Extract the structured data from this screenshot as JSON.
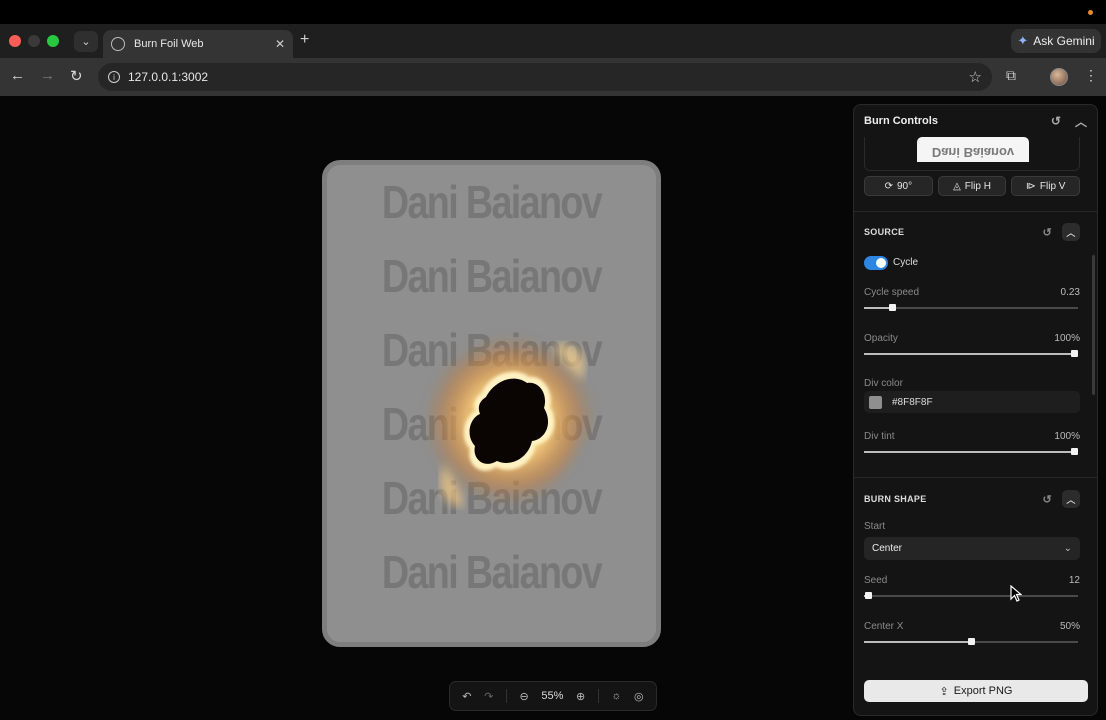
{
  "browser": {
    "tab_title": "Burn Foil Web",
    "url": "127.0.0.1:3002",
    "gemini_label": "Ask Gemini"
  },
  "canvas": {
    "watermark_text": "Dani Baianov",
    "zoom_label": "55%"
  },
  "panel": {
    "title": "Burn Controls",
    "preview_text": "Dani Baianov",
    "buttons": {
      "rotate": "90°",
      "flip_h": "Flip H",
      "flip_v": "Flip V"
    },
    "source": {
      "title": "SOURCE",
      "cycle_label": "Cycle",
      "cycle_on": true,
      "cycle_speed_label": "Cycle speed",
      "cycle_speed_value": "0.23",
      "cycle_speed_fraction": 0.13,
      "opacity_label": "Opacity",
      "opacity_value": "100%",
      "opacity_fraction": 1.0,
      "div_color_label": "Div color",
      "div_color_value": "#8F8F8F",
      "div_tint_label": "Div tint",
      "div_tint_value": "100%",
      "div_tint_fraction": 1.0
    },
    "burn_shape": {
      "title": "BURN SHAPE",
      "start_label": "Start",
      "start_value": "Center",
      "seed_label": "Seed",
      "seed_value": "12",
      "seed_fraction": 0.02,
      "center_x_label": "Center X",
      "center_x_value": "50%",
      "center_x_fraction": 0.5
    },
    "export_label": "Export PNG"
  },
  "colors": {
    "accent": "#2D87E2",
    "card_gray": "#8F8F8F"
  }
}
